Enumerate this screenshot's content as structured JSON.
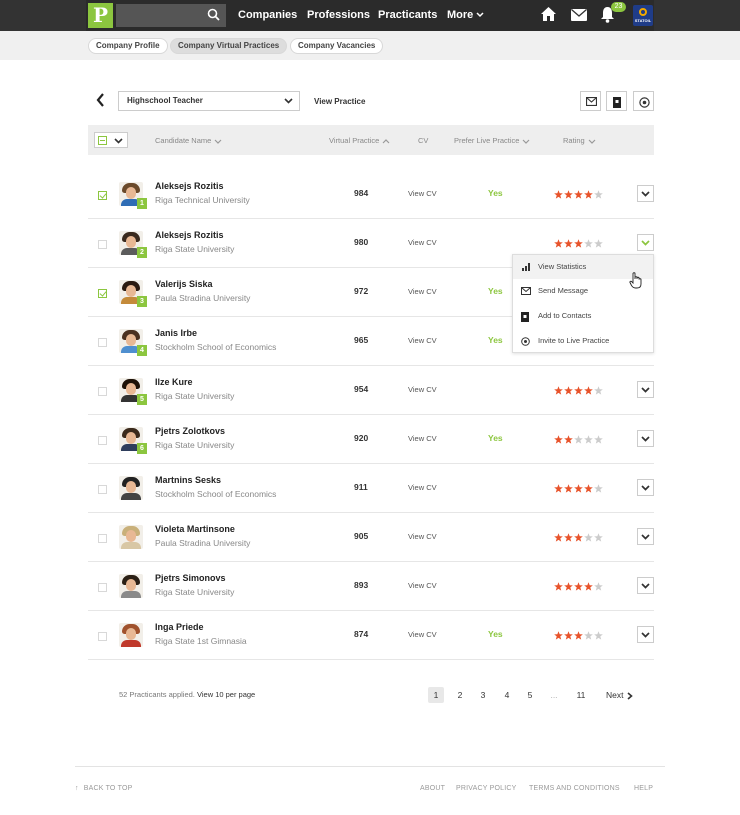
{
  "topbar": {
    "logo": "P",
    "nav": [
      "Companies",
      "Professions",
      "Practicants",
      "More"
    ],
    "notifications": "23",
    "avatar_label": "STATOIL"
  },
  "subtabs": [
    "Company Profile",
    "Company Virtual Practices",
    "Company Vacancies"
  ],
  "filters": {
    "practice": "Highschool Teacher",
    "view_practice": "View Practice"
  },
  "table": {
    "headers": {
      "name": "Candidate Name",
      "practice": "Virtual Practice",
      "cv": "CV",
      "live": "Prefer Live Practice",
      "rating": "Rating"
    },
    "rows": [
      {
        "name": "Aleksejs Rozitis",
        "uni": "Riga Technical University",
        "score": "984",
        "cv": "View CV",
        "live": "Yes",
        "rating": 4,
        "checked": true,
        "rank": "1"
      },
      {
        "name": "Aleksejs Rozitis",
        "uni": "Riga State University",
        "score": "980",
        "cv": "View CV",
        "live": "",
        "rating": 3,
        "checked": false,
        "rank": "2"
      },
      {
        "name": "Valerijs Siska",
        "uni": "Paula Stradina University",
        "score": "972",
        "cv": "View CV",
        "live": "Yes",
        "rating": 0,
        "checked": true,
        "rank": "3"
      },
      {
        "name": "Janis Irbe",
        "uni": "Stockholm School of Economics",
        "score": "965",
        "cv": "View CV",
        "live": "Yes",
        "rating": 0,
        "checked": false,
        "rank": "4"
      },
      {
        "name": "Ilze Kure",
        "uni": "Riga State University",
        "score": "954",
        "cv": "View CV",
        "live": "",
        "rating": 4,
        "checked": false,
        "rank": "5"
      },
      {
        "name": "Pjetrs Zolotkovs",
        "uni": "Riga State University",
        "score": "920",
        "cv": "View CV",
        "live": "Yes",
        "rating": 2,
        "checked": false,
        "rank": "6"
      },
      {
        "name": "Martnins Sesks",
        "uni": "Stockholm School of Economics",
        "score": "911",
        "cv": "View CV",
        "live": "",
        "rating": 4,
        "checked": false,
        "rank": ""
      },
      {
        "name": "Violeta Martinsone",
        "uni": "Paula Stradina University",
        "score": "905",
        "cv": "View CV",
        "live": "",
        "rating": 3,
        "checked": false,
        "rank": ""
      },
      {
        "name": "Pjetrs Simonovs",
        "uni": "Riga State University",
        "score": "893",
        "cv": "View CV",
        "live": "",
        "rating": 4,
        "checked": false,
        "rank": ""
      },
      {
        "name": "Inga Priede",
        "uni": "Riga State 1st Gimnasia",
        "score": "874",
        "cv": "View CV",
        "live": "Yes",
        "rating": 3,
        "checked": false,
        "rank": ""
      }
    ]
  },
  "dropdown": {
    "items": [
      "View Statistics",
      "Send Message",
      "Add to Contacts",
      "Invite to Live Practice"
    ]
  },
  "pagination": {
    "applied": "52 Practicants applied.",
    "per_page": "View 10 per page",
    "pages": [
      "1",
      "2",
      "3",
      "4",
      "5",
      "...",
      "11"
    ],
    "next": "Next"
  },
  "footer": {
    "back_to_top": "BACK TO TOP",
    "links": [
      "ABOUT",
      "PRIVACY POLICY",
      "TERMS AND CONDITIONS",
      "HELP"
    ]
  },
  "colors": {
    "accent": "#8cc63f",
    "star_on": "#e8532b",
    "star_off": "#cccccc",
    "topbar": "#333333"
  }
}
